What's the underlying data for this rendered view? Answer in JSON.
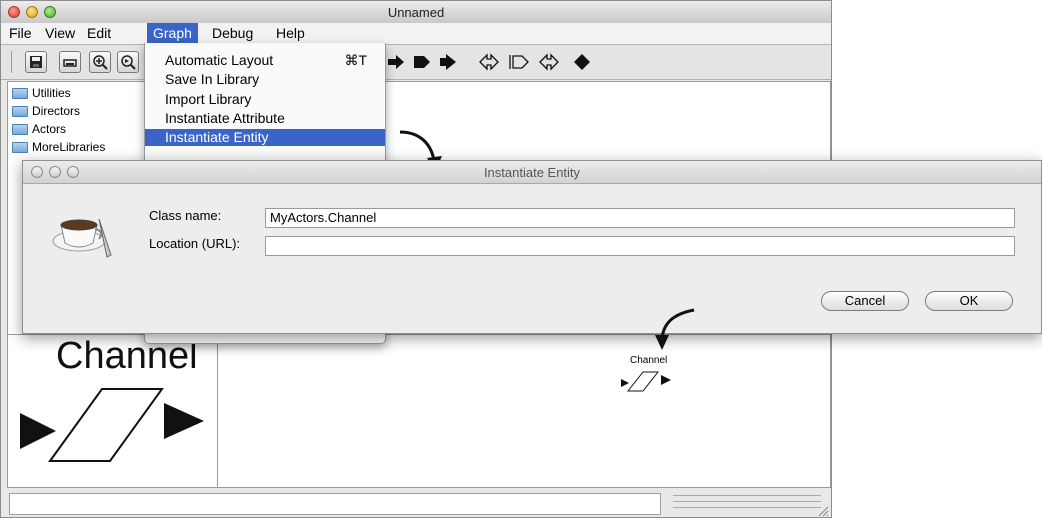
{
  "window": {
    "title": "Unnamed",
    "menus": [
      "File",
      "View",
      "Edit",
      "Graph",
      "Debug",
      "Help"
    ],
    "active_menu": "Graph"
  },
  "library_tree": {
    "items": [
      "Utilities",
      "Directors",
      "Actors",
      "MoreLibraries"
    ]
  },
  "graph_menu": {
    "items": [
      {
        "label": "Automatic Layout",
        "shortcut": "⌘T"
      },
      {
        "label": "Save In Library"
      },
      {
        "label": "Import Library"
      },
      {
        "label": "Instantiate Attribute"
      },
      {
        "label": "Instantiate Entity"
      }
    ],
    "highlighted": "Instantiate Entity"
  },
  "dialog": {
    "title": "Instantiate Entity",
    "class_name_label": "Class name:",
    "class_name_value": "MyActors.Channel",
    "location_label": "Location (URL):",
    "location_value": "",
    "cancel_label": "Cancel",
    "ok_label": "OK"
  },
  "canvas": {
    "channel_small_label": "Channel",
    "channel_big_label": "Channel"
  },
  "colors": {
    "menu_highlight": "#3b64c8",
    "window_bg": "#e8e8e8"
  }
}
